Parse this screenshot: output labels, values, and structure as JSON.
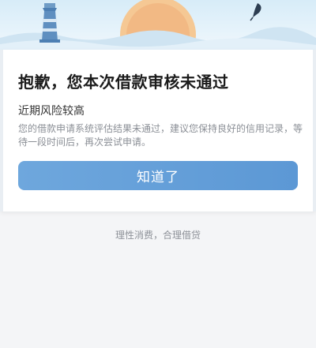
{
  "result": {
    "title": "抱歉，您本次借款审核未通过",
    "reason": "近期风险较高",
    "description": "您的借款申请系统评估结果未通过，建议您保持良好的信用记录，等待一段时间后，再次尝试申请。",
    "confirm_button": "知道了"
  },
  "footer": {
    "slogan": "理性消费，合理借贷"
  },
  "colors": {
    "button": "#5c98d5",
    "sun": "#f2b984",
    "sky": "#d7ecf8"
  },
  "icons": [
    "lighthouse-icon",
    "sun-icon",
    "cloud-icon",
    "quill-icon"
  ]
}
